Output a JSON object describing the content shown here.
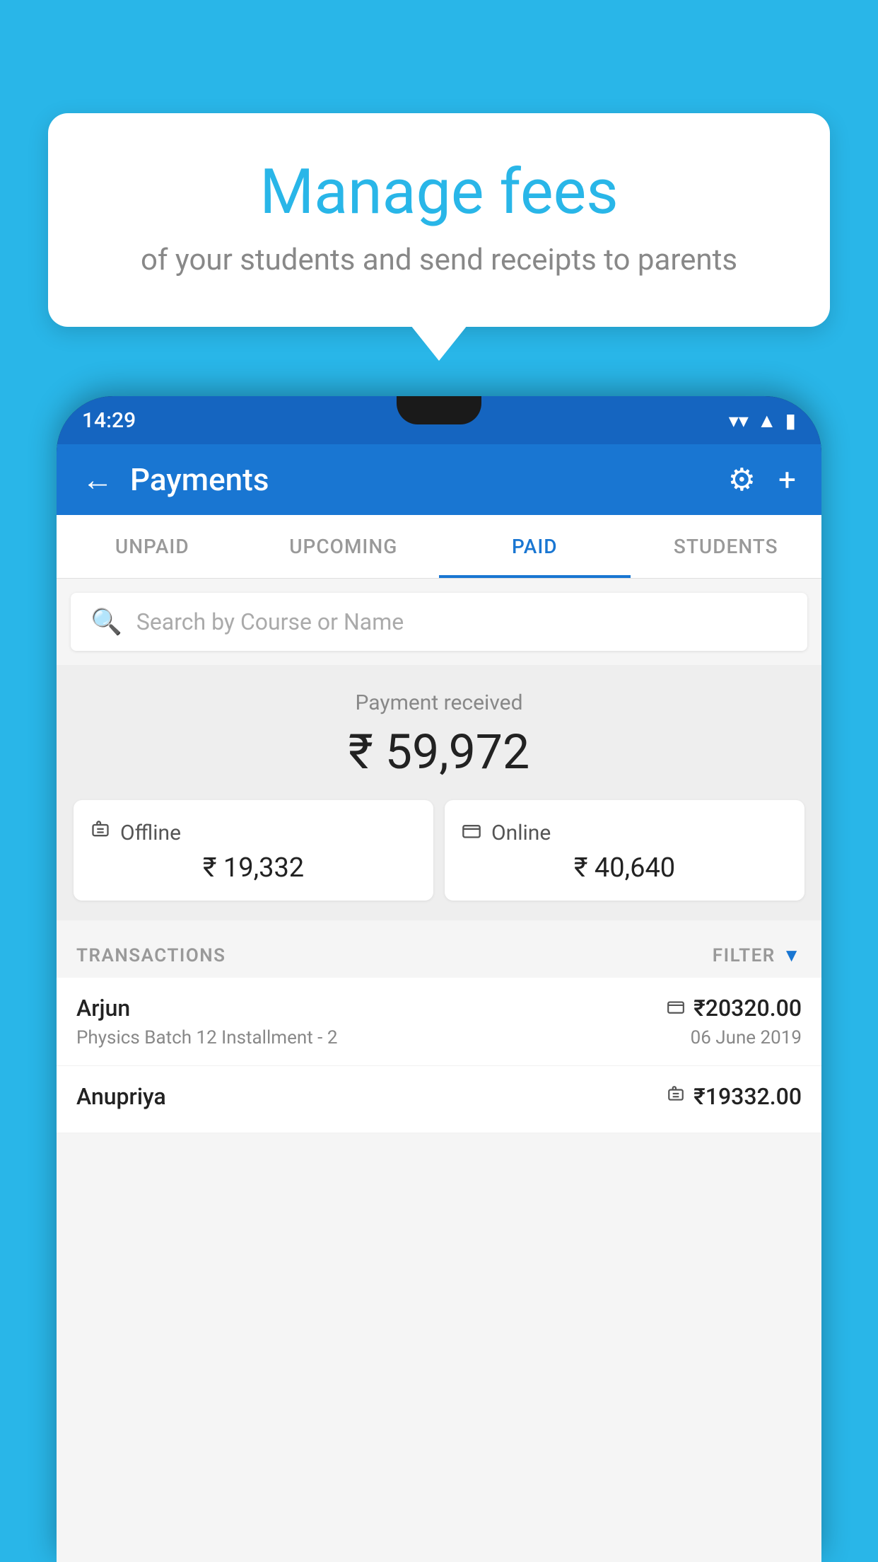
{
  "background": {
    "color": "#29b6e8"
  },
  "speech_bubble": {
    "title": "Manage fees",
    "subtitle": "of your students and send receipts to parents"
  },
  "status_bar": {
    "time": "14:29",
    "wifi": "▼",
    "signal": "▲",
    "battery": "▮"
  },
  "app_header": {
    "title": "Payments",
    "back_label": "←",
    "settings_label": "⚙",
    "add_label": "+"
  },
  "tabs": [
    {
      "label": "UNPAID",
      "active": false
    },
    {
      "label": "UPCOMING",
      "active": false
    },
    {
      "label": "PAID",
      "active": true
    },
    {
      "label": "STUDENTS",
      "active": false
    }
  ],
  "search": {
    "placeholder": "Search by Course or Name"
  },
  "payment_summary": {
    "label": "Payment received",
    "total_amount": "₹ 59,972",
    "offline_label": "Offline",
    "offline_amount": "₹ 19,332",
    "online_label": "Online",
    "online_amount": "₹ 40,640"
  },
  "transactions": {
    "section_label": "TRANSACTIONS",
    "filter_label": "FILTER",
    "items": [
      {
        "name": "Arjun",
        "amount": "₹20320.00",
        "detail": "Physics Batch 12 Installment - 2",
        "date": "06 June 2019",
        "payment_type": "online"
      },
      {
        "name": "Anupriya",
        "amount": "₹19332.00",
        "detail": "",
        "date": "",
        "payment_type": "offline"
      }
    ]
  }
}
